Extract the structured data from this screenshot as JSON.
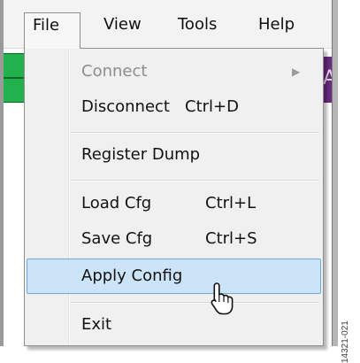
{
  "menubar": {
    "items": [
      {
        "label": "File"
      },
      {
        "label": "View"
      },
      {
        "label": "Tools"
      },
      {
        "label": "Help"
      }
    ]
  },
  "background": {
    "purple_bar_glyph": "A",
    "colors": {
      "green_bar": "#22b14c",
      "purple_bar": "#6a2a7e"
    }
  },
  "file_menu": {
    "items": [
      {
        "label": "Connect",
        "shortcut": "",
        "disabled": true,
        "has_submenu": true,
        "submenu_icon": "chevron-right-icon"
      },
      {
        "label": "Disconnect",
        "shortcut": "Ctrl+D"
      },
      {
        "label": "Register Dump",
        "shortcut": ""
      },
      {
        "label": "Load Cfg",
        "shortcut": "Ctrl+L"
      },
      {
        "label": "Save Cfg",
        "shortcut": "Ctrl+S"
      },
      {
        "label": "Apply Config",
        "shortcut": "",
        "highlighted": true
      },
      {
        "label": "Exit",
        "shortcut": ""
      }
    ],
    "highlight_color": "#cce4f7",
    "highlight_border_color": "#70a8d8"
  },
  "cursor": {
    "icon": "hand-pointer-icon"
  },
  "figure_id": "14321-021"
}
